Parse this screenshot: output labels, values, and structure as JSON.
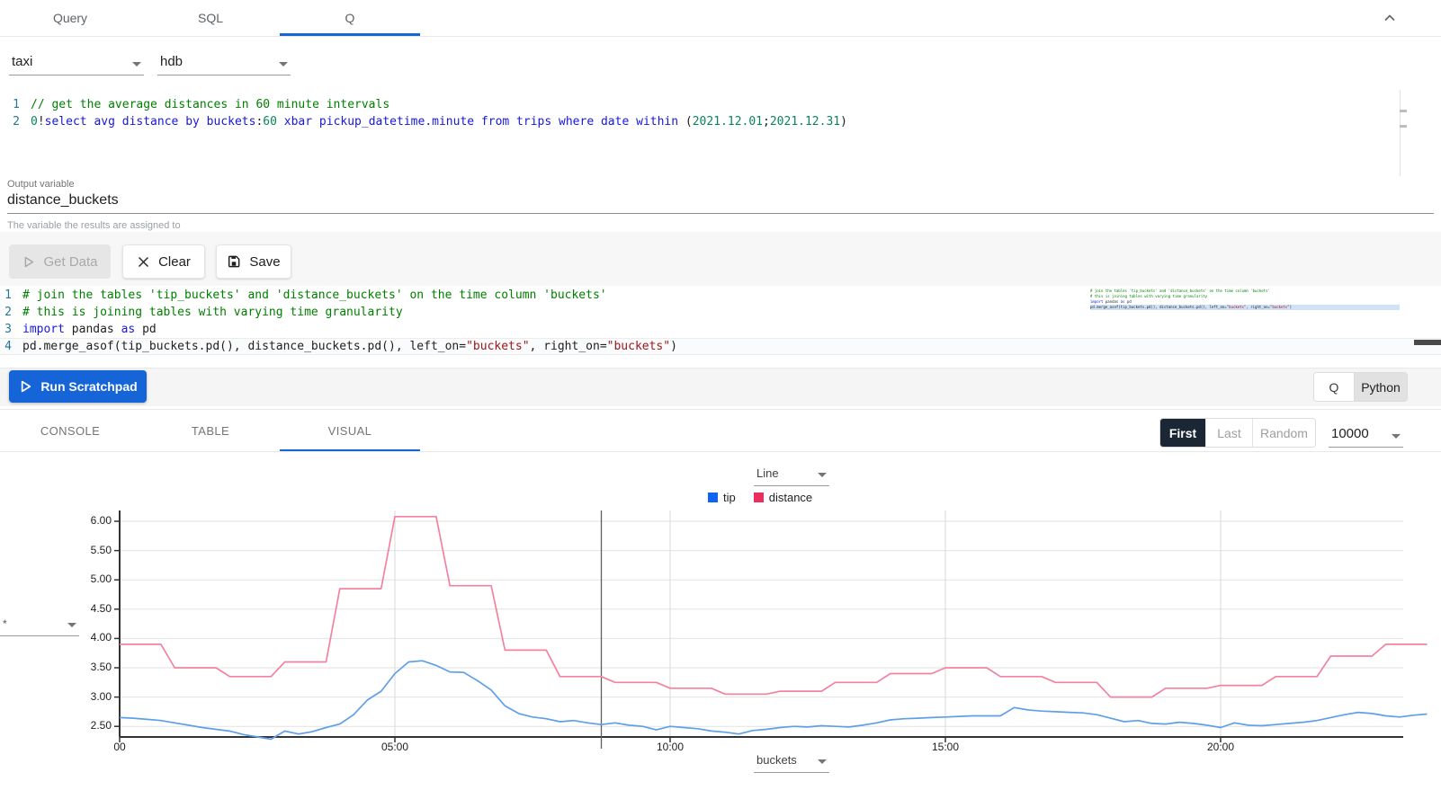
{
  "header": {
    "tabs": [
      {
        "label": "Query"
      },
      {
        "label": "SQL"
      },
      {
        "label": "Q"
      }
    ],
    "selected_tab": "Q",
    "collapse_icon": "chevron-up"
  },
  "connection": {
    "value": "taxi"
  },
  "database": {
    "value": "hdb"
  },
  "qEditor": {
    "lines": [
      {
        "num": "1",
        "tokens": [
          {
            "t": "// get the average distances in 60 minute intervals",
            "c": "com"
          }
        ]
      },
      {
        "num": "2",
        "tokens": [
          {
            "t": "0",
            "c": "num"
          },
          {
            "t": "!",
            "c": "pl"
          },
          {
            "t": "select avg distance by buckets",
            "c": "kw"
          },
          {
            "t": ":",
            "c": "pl"
          },
          {
            "t": "60",
            "c": "num"
          },
          {
            "t": " xbar pickup_datetime.minute from trips where date within ",
            "c": "kw"
          },
          {
            "t": "(",
            "c": "pl"
          },
          {
            "t": "2021.12.01",
            "c": "num"
          },
          {
            "t": ";",
            "c": "pl"
          },
          {
            "t": "2021.12.31",
            "c": "num"
          },
          {
            "t": ")",
            "c": "pl"
          }
        ]
      }
    ]
  },
  "outputVariable": {
    "label": "Output variable",
    "value": "distance_buckets",
    "helper": "The variable the results are assigned to"
  },
  "actions": {
    "get_data": "Get Data",
    "clear": "Clear",
    "save": "Save",
    "run": "Run Scratchpad"
  },
  "pyEditor": {
    "lines": [
      {
        "num": "1",
        "tokens": [
          {
            "t": "# join the tables 'tip_buckets' and 'distance_buckets' on the time column 'buckets'",
            "c": "com"
          }
        ]
      },
      {
        "num": "2",
        "tokens": [
          {
            "t": "# this is joining tables with varying time granularity",
            "c": "com"
          }
        ]
      },
      {
        "num": "3",
        "tokens": [
          {
            "t": "import",
            "c": "kw"
          },
          {
            "t": " pandas ",
            "c": "pl"
          },
          {
            "t": "as",
            "c": "kw"
          },
          {
            "t": " pd",
            "c": "pl"
          }
        ]
      },
      {
        "num": "4",
        "current": true,
        "tokens": [
          {
            "t": "pd.merge_asof(tip_buckets.pd(), distance_buckets.pd(), left_on=",
            "c": "pl"
          },
          {
            "t": "\"buckets\"",
            "c": "str"
          },
          {
            "t": ", right_on=",
            "c": "pl"
          },
          {
            "t": "\"buckets\"",
            "c": "str"
          },
          {
            "t": ")",
            "c": "pl"
          }
        ]
      }
    ]
  },
  "langToggle": {
    "options": [
      "Q",
      "Python"
    ],
    "selected": "Python"
  },
  "resultTabs": {
    "items": [
      "CONSOLE",
      "TABLE",
      "VISUAL"
    ],
    "selected": "VISUAL"
  },
  "sampling": {
    "options": [
      "First",
      "Last",
      "Random"
    ],
    "selected": "First",
    "count": "10000"
  },
  "chart_data": {
    "type": "line",
    "chart_type_selector": "Line",
    "series_filter": "*",
    "x_axis_field": "buckets",
    "legend": [
      {
        "name": "tip",
        "color": "#1063f0"
      },
      {
        "name": "distance",
        "color": "#ec2d5e"
      }
    ],
    "y_ticks": [
      "6.00",
      "5.50",
      "5.00",
      "4.50",
      "4.00",
      "3.50",
      "3.00",
      "2.50"
    ],
    "ylim": [
      2.25,
      6.15
    ],
    "x_ticks": [
      {
        "label": "00",
        "hour": 0
      },
      {
        "label": "05:00",
        "hour": 5
      },
      {
        "label": "10:00",
        "hour": 10
      },
      {
        "label": "15:00",
        "hour": 15
      },
      {
        "label": "20:00",
        "hour": 20
      }
    ],
    "x_start_hour": 0,
    "x_step_hours": 0.25,
    "grid": true,
    "crosshair_hour": 8.75,
    "series": [
      {
        "name": "tip",
        "line_color": "#5f9fe8",
        "values": [
          2.65,
          2.64,
          2.62,
          2.6,
          2.56,
          2.52,
          2.48,
          2.45,
          2.42,
          2.36,
          2.32,
          2.28,
          2.42,
          2.37,
          2.41,
          2.48,
          2.54,
          2.7,
          2.95,
          3.1,
          3.4,
          3.6,
          3.62,
          3.54,
          3.43,
          3.42,
          3.28,
          3.12,
          2.85,
          2.72,
          2.66,
          2.63,
          2.58,
          2.6,
          2.56,
          2.53,
          2.56,
          2.52,
          2.5,
          2.44,
          2.5,
          2.48,
          2.46,
          2.42,
          2.4,
          2.37,
          2.43,
          2.45,
          2.48,
          2.5,
          2.49,
          2.51,
          2.5,
          2.49,
          2.52,
          2.56,
          2.61,
          2.63,
          2.64,
          2.65,
          2.66,
          2.67,
          2.68,
          2.68,
          2.68,
          2.82,
          2.78,
          2.76,
          2.75,
          2.74,
          2.73,
          2.7,
          2.64,
          2.58,
          2.6,
          2.55,
          2.54,
          2.57,
          2.55,
          2.52,
          2.48,
          2.56,
          2.52,
          2.51,
          2.53,
          2.55,
          2.57,
          2.6,
          2.65,
          2.7,
          2.74,
          2.72,
          2.68,
          2.66,
          2.69,
          2.71
        ]
      },
      {
        "name": "distance",
        "line_color": "#f2829f",
        "values": [
          3.9,
          3.9,
          3.9,
          3.9,
          3.5,
          3.5,
          3.5,
          3.5,
          3.35,
          3.35,
          3.35,
          3.35,
          3.6,
          3.6,
          3.6,
          3.6,
          4.85,
          4.85,
          4.85,
          4.85,
          6.08,
          6.08,
          6.08,
          6.08,
          4.9,
          4.9,
          4.9,
          4.9,
          3.8,
          3.8,
          3.8,
          3.8,
          3.35,
          3.35,
          3.35,
          3.35,
          3.25,
          3.25,
          3.25,
          3.25,
          3.15,
          3.15,
          3.15,
          3.15,
          3.05,
          3.05,
          3.05,
          3.05,
          3.1,
          3.1,
          3.1,
          3.1,
          3.25,
          3.25,
          3.25,
          3.25,
          3.4,
          3.4,
          3.4,
          3.4,
          3.5,
          3.5,
          3.5,
          3.5,
          3.35,
          3.35,
          3.35,
          3.35,
          3.25,
          3.25,
          3.25,
          3.25,
          3.0,
          3.0,
          3.0,
          3.0,
          3.15,
          3.15,
          3.15,
          3.15,
          3.2,
          3.2,
          3.2,
          3.2,
          3.35,
          3.35,
          3.35,
          3.35,
          3.7,
          3.7,
          3.7,
          3.7,
          3.9,
          3.9,
          3.9,
          3.9
        ]
      }
    ]
  }
}
